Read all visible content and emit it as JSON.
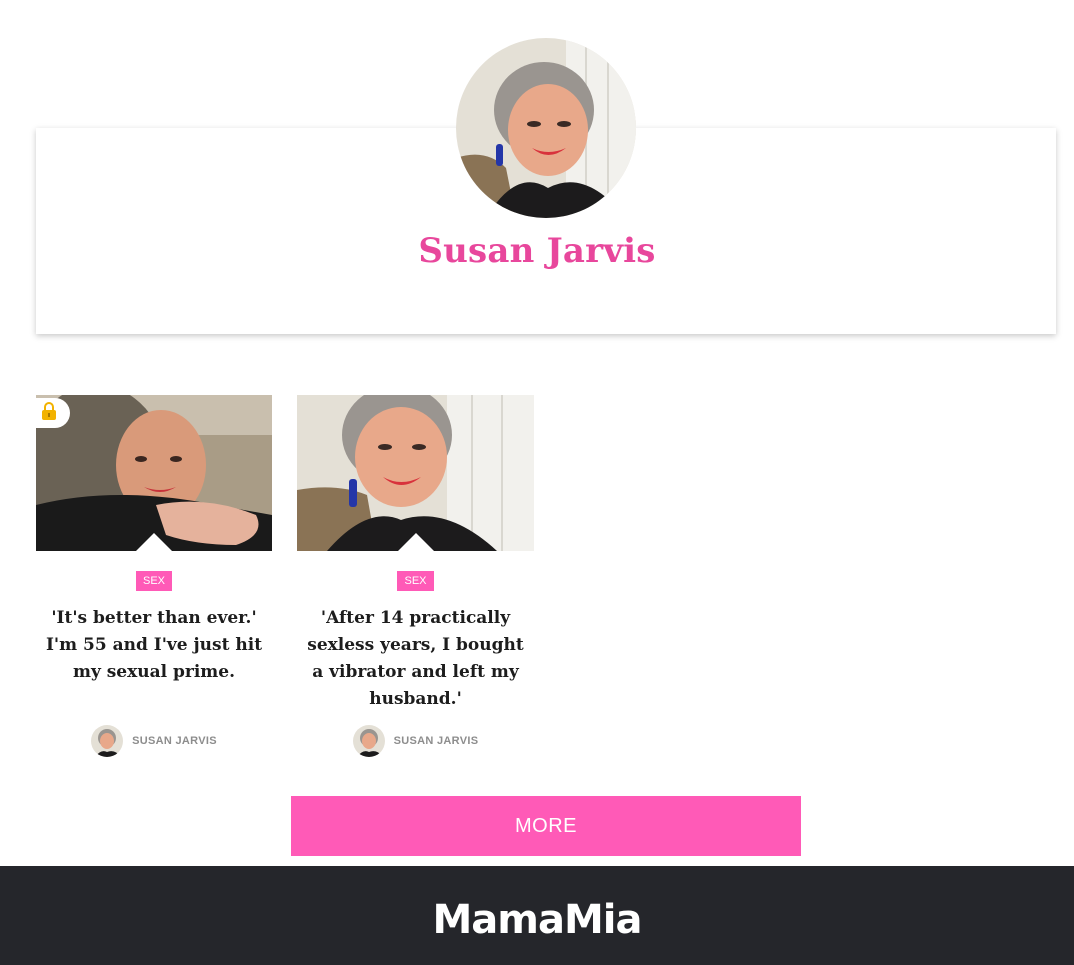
{
  "author": {
    "name": "Susan Jarvis"
  },
  "articles": [
    {
      "tag": "SEX",
      "title": "'It's better than ever.' I'm 55 and I've just hit my sexual prime.",
      "author": "SUSAN JARVIS",
      "locked": true
    },
    {
      "tag": "SEX",
      "title": "'After 14 practically sexless years, I bought a vibrator and left my husband.'",
      "author": "SUSAN JARVIS",
      "locked": false
    }
  ],
  "more_button": {
    "label": "MORE"
  },
  "footer": {
    "logo_text": "MamaMia"
  },
  "colors": {
    "accent_pink": "#ff5ab7",
    "name_pink": "#e8479c",
    "footer_bg": "#25262b"
  },
  "icons": {
    "lock": "lock-icon"
  }
}
